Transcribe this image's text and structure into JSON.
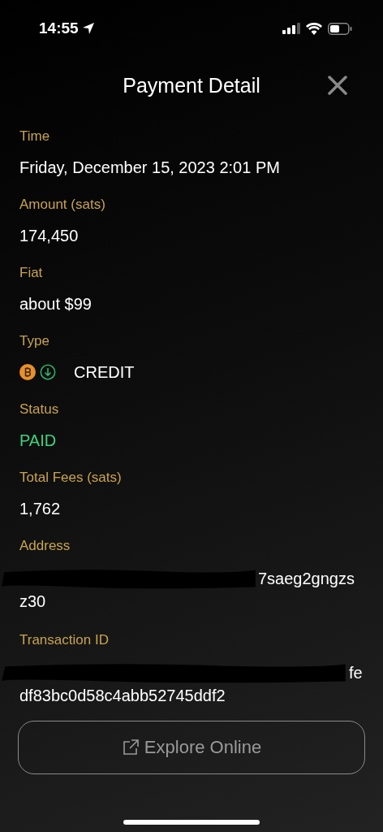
{
  "status_bar": {
    "time": "14:55"
  },
  "header": {
    "title": "Payment Detail"
  },
  "fields": [
    {
      "label": "Time",
      "kind": "text",
      "value": "Friday, December 15, 2023 2:01 PM"
    },
    {
      "label": "Amount (sats)",
      "kind": "text",
      "value": "174,450"
    },
    {
      "label": "Fiat",
      "kind": "text",
      "value": "about $99"
    },
    {
      "label": "Type",
      "kind": "type",
      "value": "CREDIT"
    },
    {
      "label": "Status",
      "kind": "status",
      "value": "PAID"
    },
    {
      "label": "Total Fees (sats)",
      "kind": "text",
      "value": "1,762"
    },
    {
      "label": "Address",
      "kind": "lines",
      "lines": [
        {
          "redacted": true,
          "text": "7saeg2gngzs"
        },
        {
          "redacted": false,
          "text": "z30"
        }
      ]
    },
    {
      "label": "Transaction ID",
      "kind": "lines",
      "lines": [
        {
          "redacted": true,
          "text": "fe"
        },
        {
          "redacted": false,
          "text": "df83bc0d58c4abb52745ddf2"
        }
      ]
    }
  ],
  "button": {
    "label": "Explore Online"
  }
}
